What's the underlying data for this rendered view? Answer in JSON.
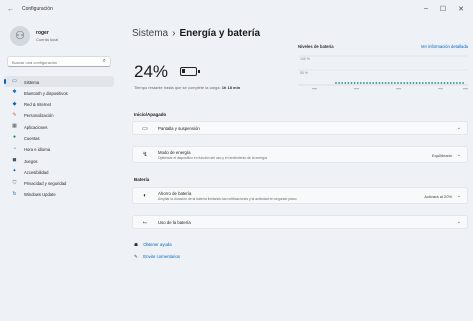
{
  "window": {
    "back_glyph": "←",
    "title": "Configuración",
    "controls": [
      "–",
      "☐",
      "✕"
    ]
  },
  "user": {
    "avatar_glyph": "⚇",
    "name": "roger",
    "account": "Cuenta local"
  },
  "search": {
    "placeholder": "Buscar una configuración",
    "icon": "search-icon"
  },
  "nav": {
    "items": [
      {
        "label": "Sistema",
        "icon": "monitor-icon",
        "color": "#0067c0",
        "active": true
      },
      {
        "label": "Bluetooth y dispositivos",
        "icon": "bluetooth-icon",
        "color": "#0067c0"
      },
      {
        "label": "Red & Internet",
        "icon": "wifi-icon",
        "color": "#0067c0"
      },
      {
        "label": "Personalización",
        "icon": "brush-icon",
        "color": "#c85b1f"
      },
      {
        "label": "Aplicaciones",
        "icon": "apps-icon",
        "color": "#4b5563"
      },
      {
        "label": "Cuentas",
        "icon": "person-icon",
        "color": "#1a8a3a"
      },
      {
        "label": "Hora e idioma",
        "icon": "globe-clock-icon",
        "color": "#0067c0"
      },
      {
        "label": "Juegos",
        "icon": "gamepad-icon",
        "color": "#4b5563"
      },
      {
        "label": "Accesibilidad",
        "icon": "accessibility-icon",
        "color": "#0067c0"
      },
      {
        "label": "Privacidad y seguridad",
        "icon": "shield-icon",
        "color": "#5b6470"
      },
      {
        "label": "Windows Update",
        "icon": "update-icon",
        "color": "#0067c0"
      }
    ]
  },
  "breadcrumb": {
    "parent": "Sistema",
    "separator": "›",
    "current": "Energía y batería"
  },
  "battery": {
    "percent_text": "24%",
    "level": 0.24,
    "estimate_prefix": "Tiempo restante hasta que se complete la carga:",
    "estimate_value": "1h 18 min"
  },
  "battery_chart": {
    "title": "Niveles de batería",
    "link": "Ver información detallada",
    "y_ticks": [
      "100 %",
      "50 %"
    ]
  },
  "sections": {
    "power": {
      "title": "Inicio/Apagado",
      "screen_sleep": {
        "label": "Pantalla y suspensión",
        "icon": "screen-sleep-icon",
        "glyph": "▭"
      },
      "power_mode": {
        "label": "Modo de energía",
        "description": "Optimizar el dispositivo en función del uso y el rendimiento de la energía",
        "icon": "power-mode-icon",
        "glyph": "↯",
        "value": "Equilibrado"
      }
    },
    "battery": {
      "title": "Batería",
      "saver": {
        "label": "Ahorro de batería",
        "description": "Ampliar la duración de la batería limitando las notificaciones y la actividad en segundo plano",
        "icon": "battery-saver-icon",
        "glyph": "◐",
        "value": "Activará al 20%"
      },
      "usage": {
        "label": "Uso de la batería",
        "icon": "battery-usage-icon",
        "glyph": "⌙"
      }
    }
  },
  "links": [
    {
      "label": "Obtener ayuda",
      "icon": "help-icon",
      "glyph": "☗"
    },
    {
      "label": "Enviar comentarios",
      "icon": "feedback-icon",
      "glyph": "✎"
    }
  ],
  "colors": {
    "accent": "#0067c0",
    "background": "#eef1f5",
    "card": "#f8f9fb"
  }
}
